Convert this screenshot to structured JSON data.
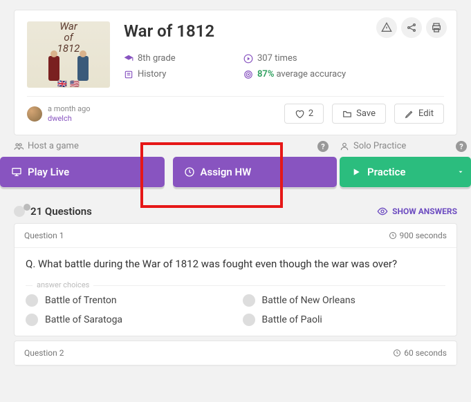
{
  "header": {
    "title": "War of 1812",
    "grade": "8th grade",
    "plays": "307 times",
    "subject": "History",
    "accuracy_pct": "87%",
    "accuracy_lbl": "average accuracy"
  },
  "thumb": {
    "line1": "War",
    "line2": "of",
    "line3": "1812"
  },
  "author": {
    "when": "a month ago",
    "name": "dwelch"
  },
  "actions": {
    "likes": "2",
    "save": "Save",
    "edit": "Edit"
  },
  "modes": {
    "host_lbl": "Host a game",
    "solo_lbl": "Solo Practice",
    "play_live": "Play Live",
    "assign_hw": "Assign HW",
    "practice": "Practice"
  },
  "questions": {
    "count_lbl": "21 Questions",
    "show_answers": "SHOW ANSWERS",
    "list": [
      {
        "num": "Question 1",
        "time": "900 seconds",
        "text": "Q. What battle during the War of 1812 was fought even though the war was over?",
        "choices": [
          "Battle of Trenton",
          "Battle of New Orleans",
          "Battle of Saratoga",
          "Battle of Paoli"
        ]
      },
      {
        "num": "Question 2",
        "time": "60 seconds",
        "text": "",
        "choices": []
      }
    ],
    "ac_label": "answer choices"
  }
}
